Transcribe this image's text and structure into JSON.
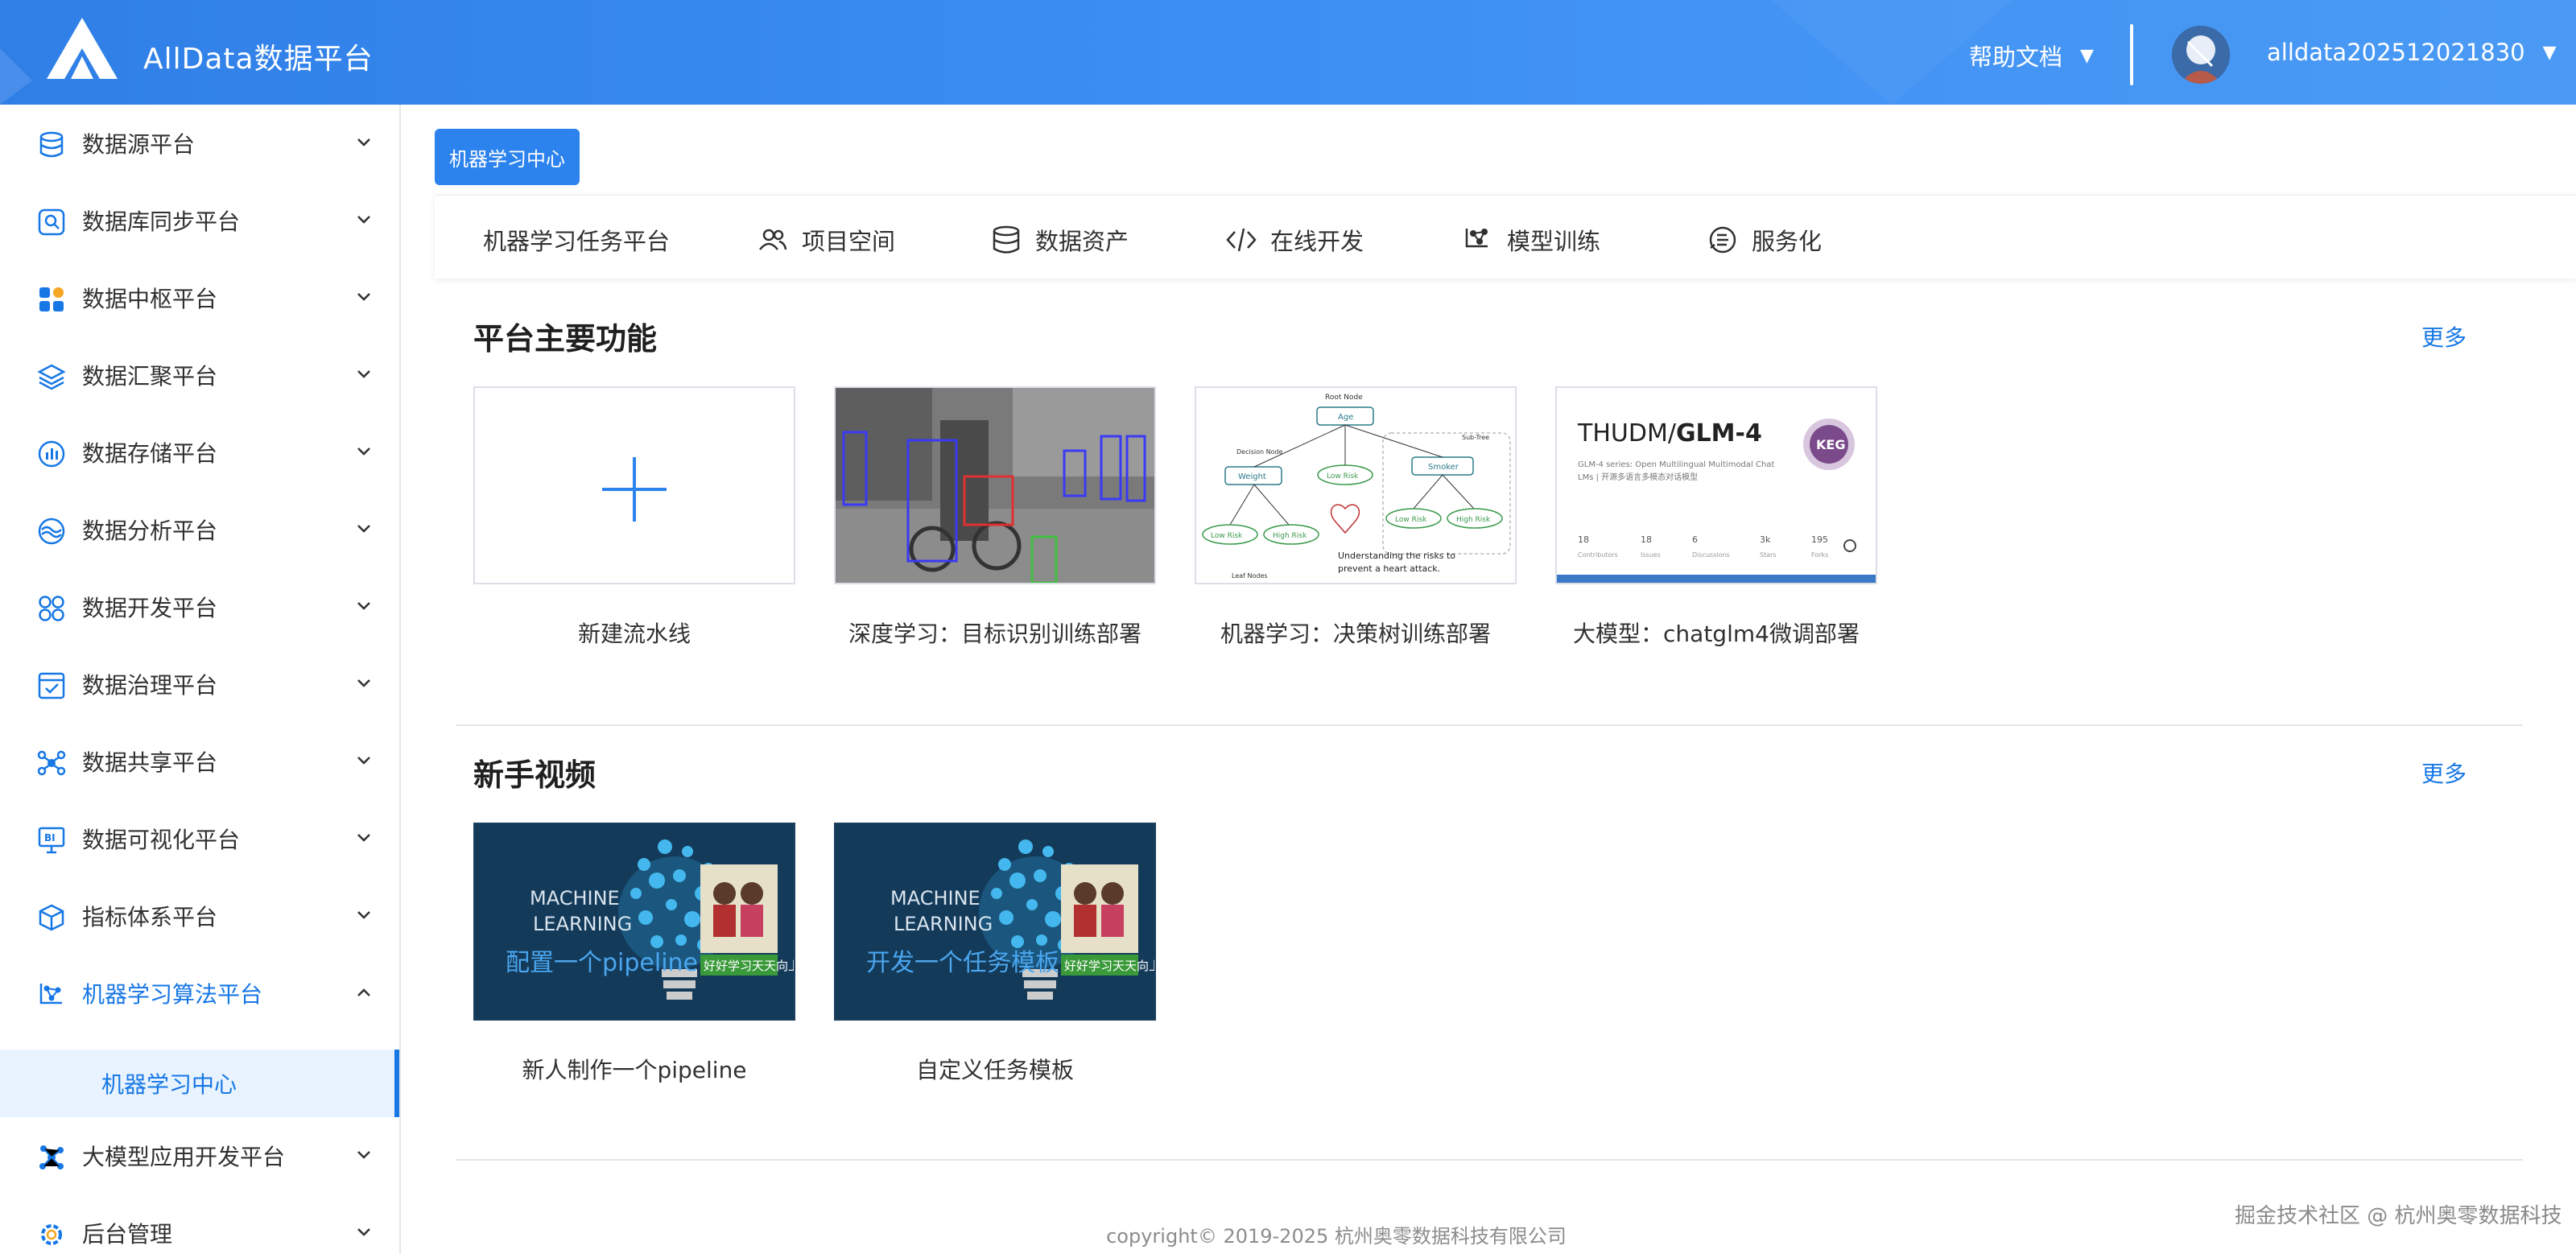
{
  "header": {
    "app_title": "AllData数据平台",
    "help_docs": "帮助文档",
    "username": "alldata202512021830",
    "caret": "▼",
    "brand_color": "#2f7fe7"
  },
  "sidebar": {
    "items": [
      {
        "label": "数据源平台",
        "icon": "database-icon"
      },
      {
        "label": "数据库同步平台",
        "icon": "search-sync-icon"
      },
      {
        "label": "数据中枢平台",
        "icon": "grid-icon"
      },
      {
        "label": "数据汇聚平台",
        "icon": "layers-icon"
      },
      {
        "label": "数据存储平台",
        "icon": "chart-circle-icon"
      },
      {
        "label": "数据分析平台",
        "icon": "wave-icon"
      },
      {
        "label": "数据开发平台",
        "icon": "four-circles-icon"
      },
      {
        "label": "数据治理平台",
        "icon": "checklist-icon"
      },
      {
        "label": "数据共享平台",
        "icon": "share-icon"
      },
      {
        "label": "数据可视化平台",
        "icon": "bi-monitor-icon"
      },
      {
        "label": "指标体系平台",
        "icon": "cube-icon"
      },
      {
        "label": "机器学习算法平台",
        "icon": "ml-node-icon"
      },
      {
        "label": "大模型应用开发平台",
        "icon": "nodes-icon"
      },
      {
        "label": "后台管理",
        "icon": "gear-icon"
      }
    ],
    "sub_item": "机器学习中心",
    "active_color": "#1677e5"
  },
  "main": {
    "tag_button": "机器学习中心",
    "tabs": [
      {
        "label": "机器学习任务平台"
      },
      {
        "label": "项目空间",
        "icon": "users-icon"
      },
      {
        "label": "数据资产",
        "icon": "database-icon"
      },
      {
        "label": "在线开发",
        "icon": "code-icon"
      },
      {
        "label": "模型训练",
        "icon": "model-icon"
      },
      {
        "label": "服务化",
        "icon": "service-icon"
      }
    ],
    "features": {
      "title": "平台主要功能",
      "more": "更多",
      "cards": [
        {
          "label": "新建流水线"
        },
        {
          "label": "深度学习：目标识别训练部署"
        },
        {
          "label": "机器学习：决策树训练部署"
        },
        {
          "label": "大模型：chatglm4微调部署"
        }
      ],
      "glm_card": {
        "repo_owner": "THUDM/",
        "repo_name": "GLM-4",
        "description_line1": "GLM-4 series: Open Multilingual Multimodal Chat",
        "description_line2": "LMs | 开源多语言多模态对话模型",
        "stats": [
          {
            "value": "18",
            "label": "Contributors"
          },
          {
            "value": "18",
            "label": "Issues"
          },
          {
            "value": "6",
            "label": "Discussions"
          },
          {
            "value": "3k",
            "label": "Stars"
          },
          {
            "value": "195",
            "label": "Forks"
          }
        ]
      },
      "tree_card": {
        "root": "Root Node",
        "age": "Age",
        "weight": "Weight",
        "low_risk": "Low Risk",
        "high_risk": "High Risk",
        "smoker": "Smoker",
        "decision_node": "Decision Node",
        "sub_tree": "Sub-Tree",
        "leaf_nodes": "Leaf Nodes",
        "caption_line1": "Understanding the risks to",
        "caption_line2": "prevent a heart attack."
      }
    },
    "videos": {
      "title": "新手视频",
      "more": "更多",
      "cards": [
        {
          "label": "新人制作一个pipeline",
          "overlay": "配置一个pipeline"
        },
        {
          "label": "自定义任务模板",
          "overlay": "开发一个任务模板"
        }
      ],
      "thumb_line1": "MACHINE",
      "thumb_line2": "LEARNING",
      "thumb_badge": "好好学习天天向上"
    },
    "copyright": "copyright© 2019-2025 杭州奥零数据科技有限公司",
    "watermark": "掘金技术社区 @ 杭州奥零数据科技"
  }
}
